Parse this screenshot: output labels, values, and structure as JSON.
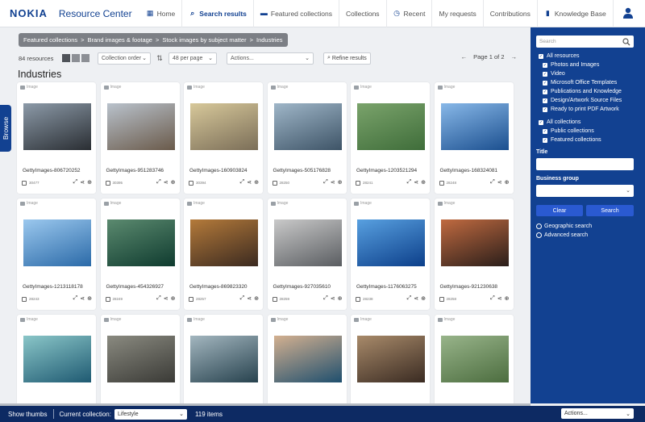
{
  "brand": {
    "logo": "NOKIA",
    "app_title": "Resource Center",
    "primary": "#124191"
  },
  "nav": [
    {
      "label": "Home",
      "icon": "grid-icon"
    },
    {
      "label": "Search results",
      "icon": "search-icon",
      "active": true
    },
    {
      "label": "Featured collections",
      "icon": "folder-icon"
    },
    {
      "label": "Collections",
      "icon": ""
    },
    {
      "label": "Recent",
      "icon": "clock-icon"
    },
    {
      "label": "My requests",
      "icon": ""
    },
    {
      "label": "Contributions",
      "icon": ""
    },
    {
      "label": "Knowledge Base",
      "icon": "book-icon"
    }
  ],
  "breadcrumb": [
    "Featured collections",
    "Brand images & footage",
    "Stock images by subject matter",
    "Industries"
  ],
  "breadcrumb_sep": ">",
  "toolbar": {
    "resources_count": "84 resources",
    "order": "Collection order",
    "per_page": "48 per page",
    "actions": "Actions...",
    "refine": "Refine results",
    "page_label": "Page 1 of 2"
  },
  "page_title": "Industries",
  "type_label": "Image",
  "cards": [
    {
      "name": "GettyImages-806720252",
      "id": "30477"
    },
    {
      "name": "GettyImages-951283746",
      "id": "30395"
    },
    {
      "name": "GettyImages-160903824",
      "id": "30394"
    },
    {
      "name": "GettyImages-505176828",
      "id": "28250"
    },
    {
      "name": "GettyImages-1203521294",
      "id": "28241"
    },
    {
      "name": "GettyImages-168324081",
      "id": "28248"
    },
    {
      "name": "GettyImages-1213118178",
      "id": "28243"
    },
    {
      "name": "GettyImages-454326927",
      "id": "28249"
    },
    {
      "name": "GettyImages-869823320",
      "id": "28257"
    },
    {
      "name": "GettyImages-927035610",
      "id": "28259"
    },
    {
      "name": "GettyImages-1176063275",
      "id": "28238"
    },
    {
      "name": "GettyImages-921230638",
      "id": "28258"
    },
    {
      "name": "",
      "id": ""
    },
    {
      "name": "",
      "id": ""
    },
    {
      "name": "",
      "id": ""
    },
    {
      "name": "",
      "id": ""
    },
    {
      "name": "",
      "id": ""
    },
    {
      "name": "",
      "id": ""
    }
  ],
  "browse_tab": "Browse",
  "sidebar": {
    "search_placeholder": "Search",
    "resources": [
      "All resources",
      "Photos and Images",
      "Video",
      "Microsoft Office Templates",
      "Publications and Knowledge",
      "Design/Artwork Source Files",
      "Ready to print PDF Artwork"
    ],
    "collections": [
      "All collections",
      "Public collections",
      "Featured collections"
    ],
    "title_label": "Title",
    "group_label": "Business group",
    "clear": "Clear",
    "search_btn": "Search",
    "geo": "Geographic search",
    "advanced": "Advanced search"
  },
  "bottombar": {
    "show_thumbs": "Show thumbs",
    "current_label": "Current collection:",
    "collection": "Lifestyle",
    "items": "119 items",
    "actions": "Actions..."
  }
}
